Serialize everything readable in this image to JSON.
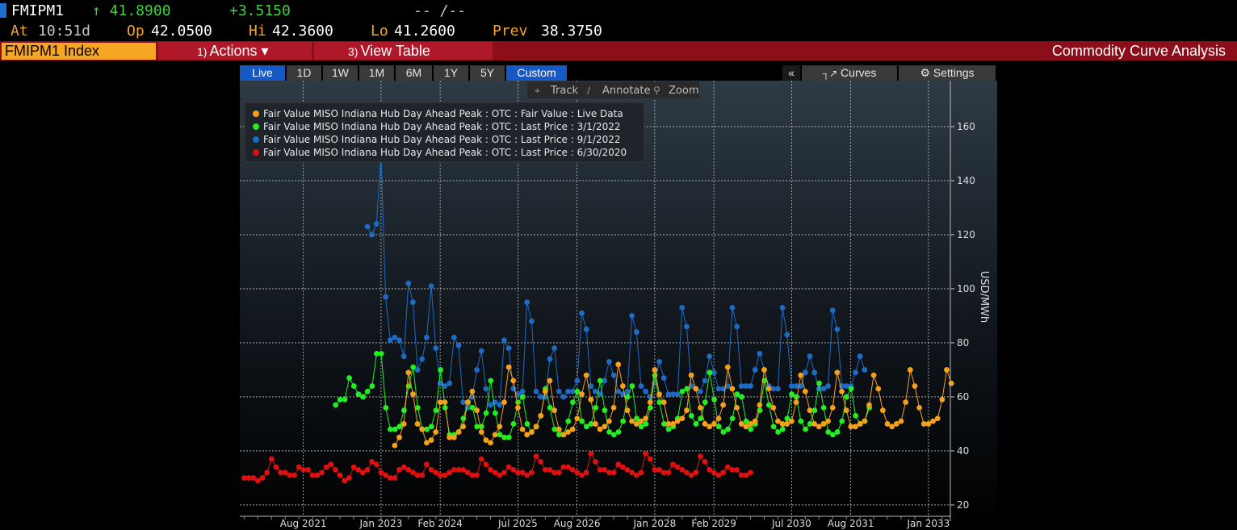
{
  "header": {
    "ticker": "FMIPM1",
    "last": "↑ 41.8900",
    "change": "+3.5150",
    "bid_ask": "-- /--",
    "at_label": "At",
    "at_value": "10:51d",
    "open_label": "Op",
    "open_value": "42.0500",
    "high_label": "Hi",
    "high_value": "42.3600",
    "low_label": "Lo",
    "low_value": "41.2600",
    "prev_label": "Prev",
    "prev_value": "38.3750"
  },
  "function_bar": {
    "security": "FMIPM1 Index",
    "actions_num": "1)",
    "actions_label": "Actions ▾",
    "viewtable_num": "3)",
    "viewtable_label": "View Table",
    "title": "Commodity Curve Analysis"
  },
  "toolbar": {
    "ranges": [
      "Live",
      "1D",
      "1W",
      "1M",
      "6M",
      "1Y",
      "5Y",
      "Custom"
    ],
    "active": [
      "Live",
      "Custom"
    ],
    "collapse": "«",
    "curves": "Curves",
    "settings": "Settings",
    "track": "Track",
    "annotate": "Annotate",
    "zoom": "Zoom"
  },
  "colors": {
    "orange": "#f5a01a",
    "green": "#22ee22",
    "blue": "#1d6bc4",
    "red": "#e01010",
    "accent": "#1659c4",
    "function_bar": "#8b0e1a"
  },
  "chart_data": {
    "type": "line",
    "ylabel": "USD/MWh",
    "ylim": [
      17,
      177
    ],
    "yticks": [
      20,
      40,
      60,
      80,
      100,
      120,
      140,
      160
    ],
    "xlim": [
      2020.42,
      2033.4
    ],
    "xticks": [
      {
        "label": "Aug 2021",
        "x": 2021.58
      },
      {
        "label": "Jan 2023",
        "x": 2023.0
      },
      {
        "label": "Feb 2024",
        "x": 2024.08
      },
      {
        "label": "Jul 2025",
        "x": 2025.5
      },
      {
        "label": "Aug 2026",
        "x": 2026.58
      },
      {
        "label": "Jan 2028",
        "x": 2028.0
      },
      {
        "label": "Feb 2029",
        "x": 2029.08
      },
      {
        "label": "Jul 2030",
        "x": 2030.5
      },
      {
        "label": "Aug 2031",
        "x": 2031.58
      },
      {
        "label": "Jan 2033",
        "x": 2033.0
      }
    ],
    "grid": true,
    "legend_position": "top-left",
    "series": [
      {
        "name": "Fair Value MISO Indiana Hub Day Ahead Peak : OTC : Fair Value : Live Data",
        "color": "#f5a01a",
        "start": 2023.25,
        "values": [
          42,
          45,
          50,
          69,
          61,
          50,
          48,
          43,
          44,
          47,
          58,
          58,
          45,
          45,
          47,
          49,
          58,
          62,
          55,
          47,
          44,
          43,
          46,
          49,
          58,
          71,
          66,
          56,
          48,
          46,
          47,
          49,
          53,
          62,
          66,
          55,
          48,
          46,
          47,
          48,
          52,
          61,
          68,
          59,
          50,
          48,
          49,
          51,
          56,
          72,
          64,
          55,
          51,
          50,
          51,
          52,
          58,
          70,
          61,
          58,
          50,
          50,
          51,
          52,
          55,
          68,
          63,
          56,
          50,
          49,
          50,
          52,
          57,
          71,
          63,
          56,
          50,
          49,
          50,
          51,
          57,
          70,
          63,
          56,
          51,
          50,
          50,
          51,
          58,
          68,
          62,
          55,
          50,
          49,
          50,
          51,
          56,
          69,
          62,
          55,
          49,
          49,
          50,
          51,
          57,
          68,
          63,
          55,
          50,
          49,
          50,
          51,
          58,
          70,
          64,
          56,
          50,
          50,
          51,
          52,
          59,
          70,
          65
        ]
      },
      {
        "name": "Fair Value MISO Indiana Hub Day Ahead Peak : OTC : Last Price : 3/1/2022",
        "color": "#22ee22",
        "start": 2022.17,
        "values": [
          57,
          59,
          59,
          67,
          64,
          61,
          60,
          62,
          64,
          76,
          76,
          56,
          48,
          48,
          49,
          55,
          64,
          71,
          56,
          48,
          48,
          49,
          55,
          70,
          56,
          46,
          46,
          47,
          52,
          58,
          56,
          49,
          49,
          54,
          66,
          54,
          46,
          45,
          45,
          50,
          58,
          60,
          50,
          47,
          49,
          53,
          63,
          56,
          48,
          46,
          46,
          51,
          58,
          62,
          51,
          49,
          50,
          56,
          66,
          55,
          47,
          46,
          47,
          51,
          60,
          64,
          52,
          49,
          50,
          56,
          68,
          58,
          50,
          48,
          49,
          52,
          62,
          63,
          53,
          50,
          52,
          58,
          69,
          59,
          49,
          47,
          48,
          52,
          61,
          60,
          51,
          48,
          50,
          55,
          66,
          57,
          49,
          47,
          48,
          52,
          61,
          60,
          51,
          48,
          50,
          55,
          65,
          56,
          47,
          46,
          47,
          51,
          60,
          63,
          53,
          50,
          51,
          56
        ]
      },
      {
        "name": "Fair Value MISO Indiana Hub Day Ahead Peak : OTC : Last Price : 9/1/2022",
        "color": "#1d6bc4",
        "start": 2022.75,
        "values": [
          123,
          120,
          124,
          150,
          97,
          81,
          82,
          81,
          75,
          102,
          95,
          70,
          74,
          82,
          101,
          78,
          65,
          64,
          65,
          82,
          79,
          58,
          56,
          60,
          70,
          77,
          63,
          57,
          58,
          57,
          81,
          78,
          63,
          61,
          62,
          95,
          88,
          62,
          60,
          60,
          74,
          78,
          62,
          60,
          62,
          62,
          66,
          91,
          85,
          64,
          62,
          61,
          66,
          73,
          68,
          62,
          61,
          62,
          90,
          84,
          64,
          62,
          60,
          65,
          73,
          67,
          61,
          61,
          61,
          93,
          86,
          64,
          63,
          62,
          66,
          75,
          69,
          63,
          63,
          64,
          93,
          86,
          64,
          64,
          64,
          70,
          76,
          70,
          64,
          63,
          63,
          93,
          83,
          64,
          64,
          64,
          69,
          75,
          69,
          63,
          63,
          64,
          92,
          85,
          64,
          64,
          64,
          69,
          75,
          70
        ]
      },
      {
        "name": "Fair Value MISO Indiana Hub Day Ahead Peak : OTC : Last Price : 6/30/2020",
        "color": "#e01010",
        "start": 2020.5,
        "values": [
          30,
          30,
          30,
          29,
          30,
          32,
          37,
          34,
          32,
          32,
          31,
          31,
          34,
          33,
          33,
          31,
          31,
          32,
          34,
          35,
          33,
          31,
          29,
          30,
          34,
          33,
          32,
          33,
          36,
          35,
          32,
          31,
          30,
          30,
          33,
          34,
          33,
          32,
          31,
          31,
          35,
          33,
          32,
          31,
          31,
          32,
          33,
          33,
          33,
          32,
          31,
          31,
          37,
          35,
          33,
          32,
          31,
          32,
          34,
          33,
          32,
          32,
          31,
          32,
          38,
          36,
          33,
          33,
          32,
          32,
          34,
          34,
          33,
          32,
          31,
          32,
          39,
          36,
          33,
          33,
          32,
          32,
          35,
          34,
          33,
          32,
          31,
          32,
          39,
          37,
          33,
          33,
          32,
          32,
          35,
          34,
          33,
          32,
          31,
          32,
          38,
          36,
          33,
          32,
          31,
          32,
          34,
          33,
          33,
          31,
          31,
          32
        ]
      }
    ]
  }
}
